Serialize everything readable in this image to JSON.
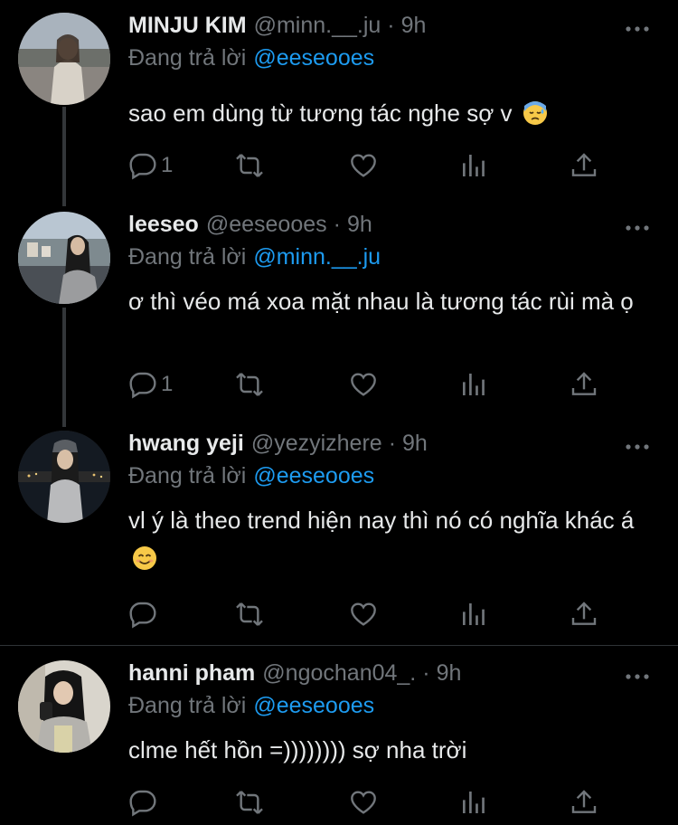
{
  "reply_prefix": "Đang trả lời",
  "tweets": [
    {
      "name": "MINJU KIM",
      "handle": "@minn.__.ju",
      "time": "9h",
      "reply_to": "@eeseooes",
      "text": "sao em dùng từ tương tác nghe sợ v",
      "emoji": "sweat-face-emoji",
      "reply_count": "1"
    },
    {
      "name": "leeseo",
      "handle": "@eeseooes",
      "time": "9h",
      "reply_to": "@minn.__.ju",
      "text": "ơ thì véo má xoa mặt nhau là tương tác rùi mà ọ",
      "emoji": "",
      "reply_count": "1"
    },
    {
      "name": "hwang yeji",
      "handle": "@yezyizhere",
      "time": "9h",
      "reply_to": "@eeseooes",
      "text": "vl ý là theo trend hiện nay thì nó có nghĩa khác á",
      "emoji": "smiling-face-emoji",
      "reply_count": ""
    },
    {
      "name": "hanni pham",
      "handle": "@ngochan04_.",
      "time": "9h",
      "reply_to": "@eeseooes",
      "text": "clme hết hồn =)))))))) sợ nha trời",
      "emoji": "",
      "reply_count": ""
    }
  ],
  "colors": {
    "background": "#000000",
    "text": "#e7e9ea",
    "muted": "#71767b",
    "accent": "#1d9bf0"
  },
  "icons": [
    "reply-icon",
    "retweet-icon",
    "like-icon",
    "views-icon",
    "share-icon",
    "more-icon"
  ]
}
